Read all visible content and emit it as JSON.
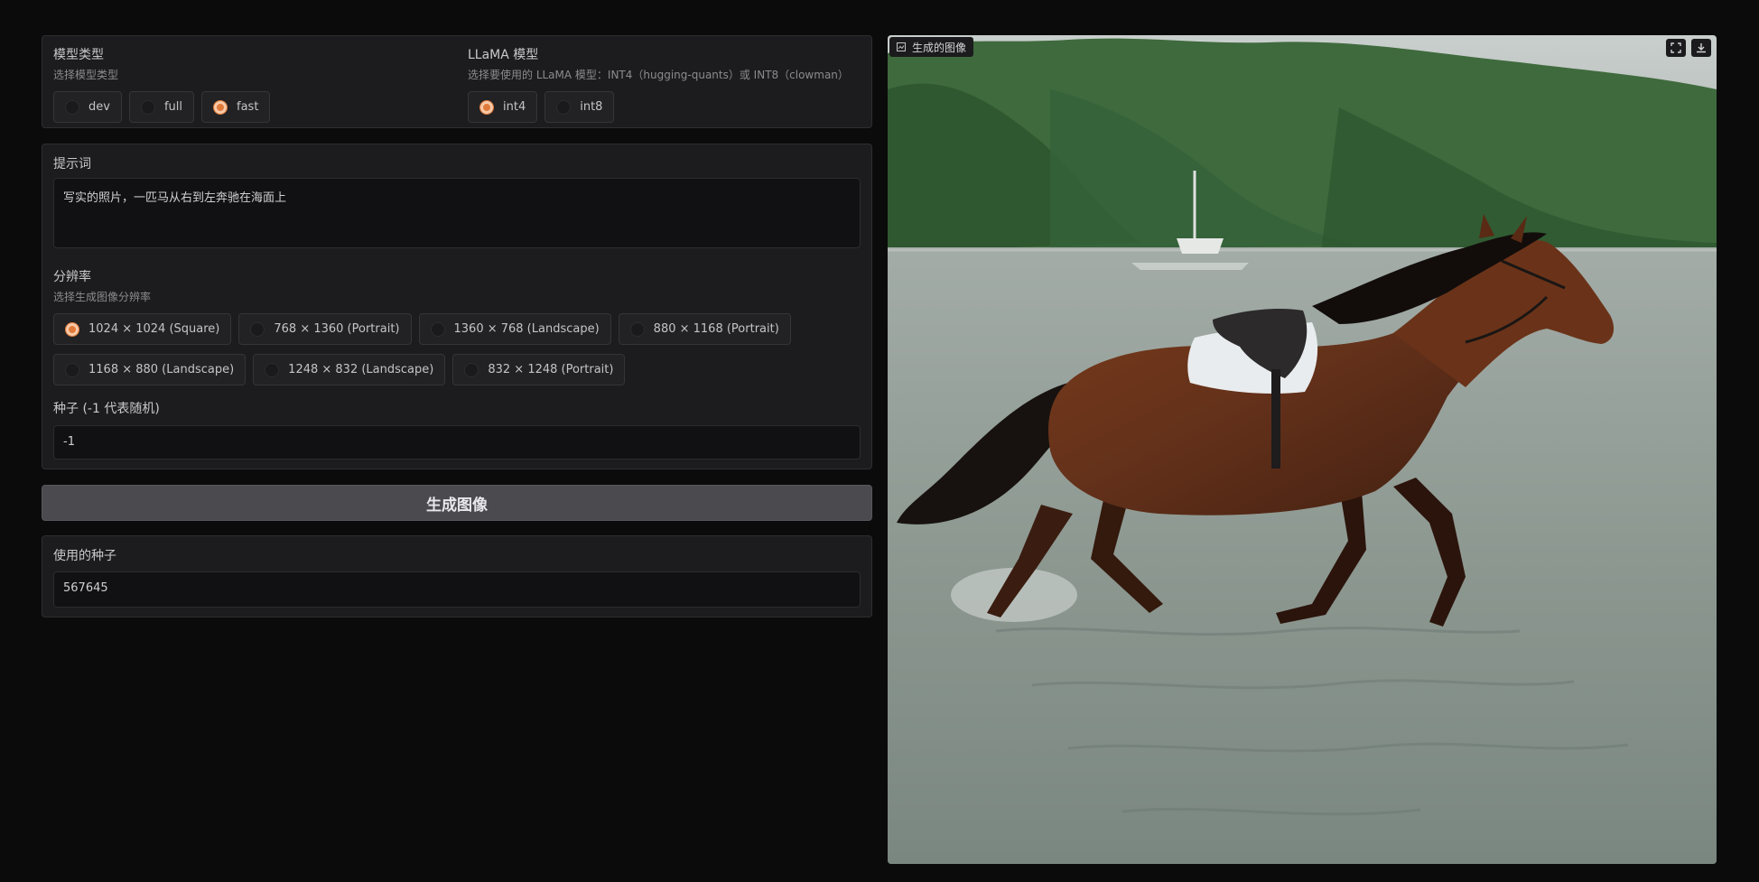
{
  "model_type": {
    "label": "模型类型",
    "info": "选择模型类型",
    "options": [
      {
        "label": "dev",
        "selected": false
      },
      {
        "label": "full",
        "selected": false
      },
      {
        "label": "fast",
        "selected": true
      }
    ]
  },
  "llama_model": {
    "label": "LLaMA 模型",
    "info": "选择要使用的 LLaMA 模型：INT4（hugging-quants）或 INT8（clowman）",
    "options": [
      {
        "label": "int4",
        "selected": true
      },
      {
        "label": "int8",
        "selected": false
      }
    ]
  },
  "prompt": {
    "label": "提示词",
    "value": "写实的照片，一匹马从右到左奔驰在海面上"
  },
  "resolution": {
    "label": "分辨率",
    "info": "选择生成图像分辨率",
    "options": [
      {
        "label": "1024 × 1024 (Square)",
        "selected": true
      },
      {
        "label": "768 × 1360 (Portrait)",
        "selected": false
      },
      {
        "label": "1360 × 768 (Landscape)",
        "selected": false
      },
      {
        "label": "880 × 1168 (Portrait)",
        "selected": false
      },
      {
        "label": "1168 × 880 (Landscape)",
        "selected": false
      },
      {
        "label": "1248 × 832 (Landscape)",
        "selected": false
      },
      {
        "label": "832 × 1248 (Portrait)",
        "selected": false
      }
    ]
  },
  "seed": {
    "label": "种子 (-1 代表随机)",
    "value": "-1"
  },
  "generate_button": {
    "label": "生成图像"
  },
  "used_seed": {
    "label": "使用的种子",
    "value": "567645"
  },
  "output_image": {
    "label": "生成的图像",
    "icons": [
      "image-icon",
      "fullscreen-icon",
      "download-icon"
    ]
  },
  "colors": {
    "accent": "#e07a3a",
    "background": "#0b0b0c",
    "panel": "#1c1c1e"
  }
}
